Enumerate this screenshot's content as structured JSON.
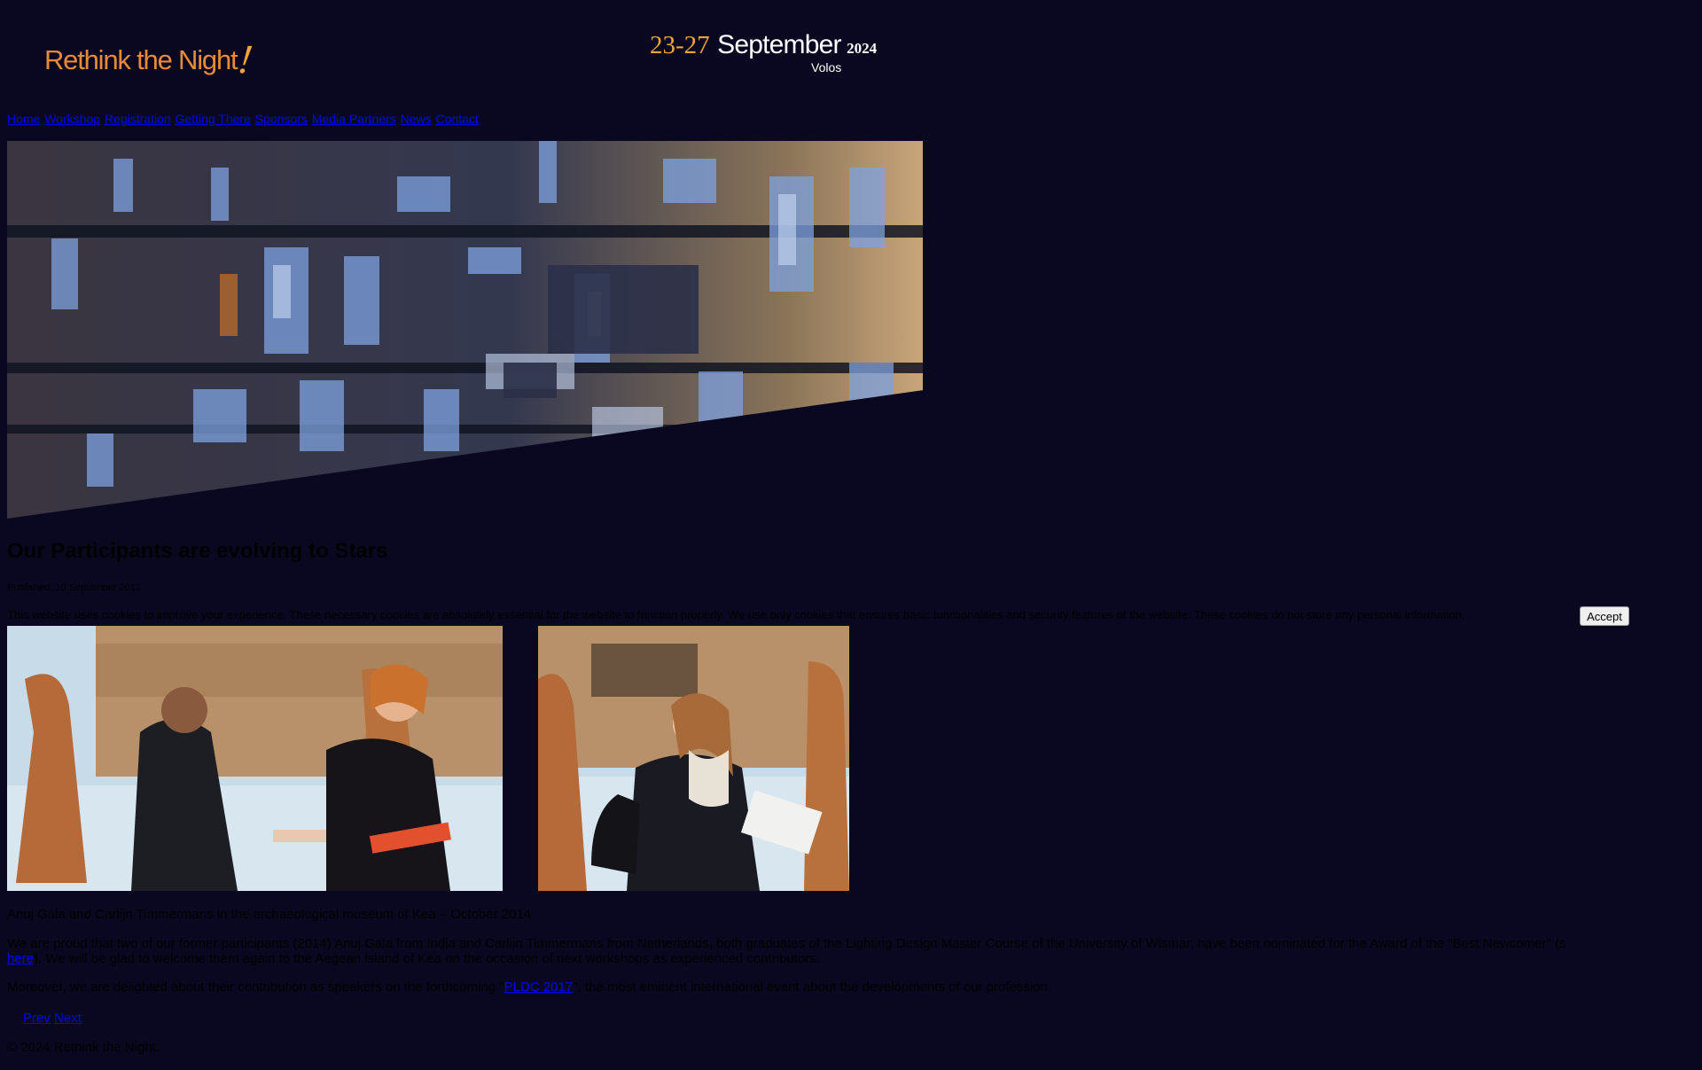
{
  "header": {
    "logo_text": "Rethink the Night",
    "logo_mark": "!",
    "date_range": "23-27",
    "month": "September",
    "year": "2024",
    "city": "Volos"
  },
  "nav": {
    "items": [
      {
        "label": "Home"
      },
      {
        "label": "Workshop"
      },
      {
        "label": "Registration"
      },
      {
        "label": "Getting There"
      },
      {
        "label": "Sponsors"
      },
      {
        "label": "Media Partners"
      },
      {
        "label": "News"
      },
      {
        "label": "Contact"
      }
    ]
  },
  "hero": {
    "description": "illuminated building facade projection"
  },
  "article": {
    "title": "Our Participants are evolving to Stars",
    "published": "Published: 10 September 2017",
    "caption": "Anuj Gala and Carlijn Timmermans in the archaeological museum of Kea – October 2014",
    "p1_before": "We are proud that two of our former participants (2014) Anuj Gala from India and Carlijn Timmermans from Netherlands, both graduates of the Lighting Design Master Course of the University of Wismar, have been nominated for the Award of the \"Best Newcomer\" (s",
    "p1_link": "here",
    "p1_after": "). We will be glad to welcome them again to the Aegean island of Kea on the occasion of next workshops as experienced contributors.",
    "p2_before": "Moreover, we are delighted about their contribution as speakers on the forthcoming \"",
    "p2_link": "PLDC 2017",
    "p2_after": "\", the most eminent international event about the developments of our profession."
  },
  "cookie": {
    "text": "This website uses cookies to improve your experience. These necessary cookies are absolutely essential for the website to function properly. We use only cookies that ensures basic functionalities and security features of the website. These cookies do not store any personal information.",
    "accept_label": "Accept"
  },
  "pager": {
    "prev_label": "Prev",
    "next_label": "Next"
  },
  "footer": {
    "copyright": "© 2024 Rethink the Night."
  },
  "colors": {
    "background": "#0a0820",
    "logo_orange": "#e98a3a",
    "date_orange": "#f0a43a",
    "link_blue": "#0000ee"
  }
}
